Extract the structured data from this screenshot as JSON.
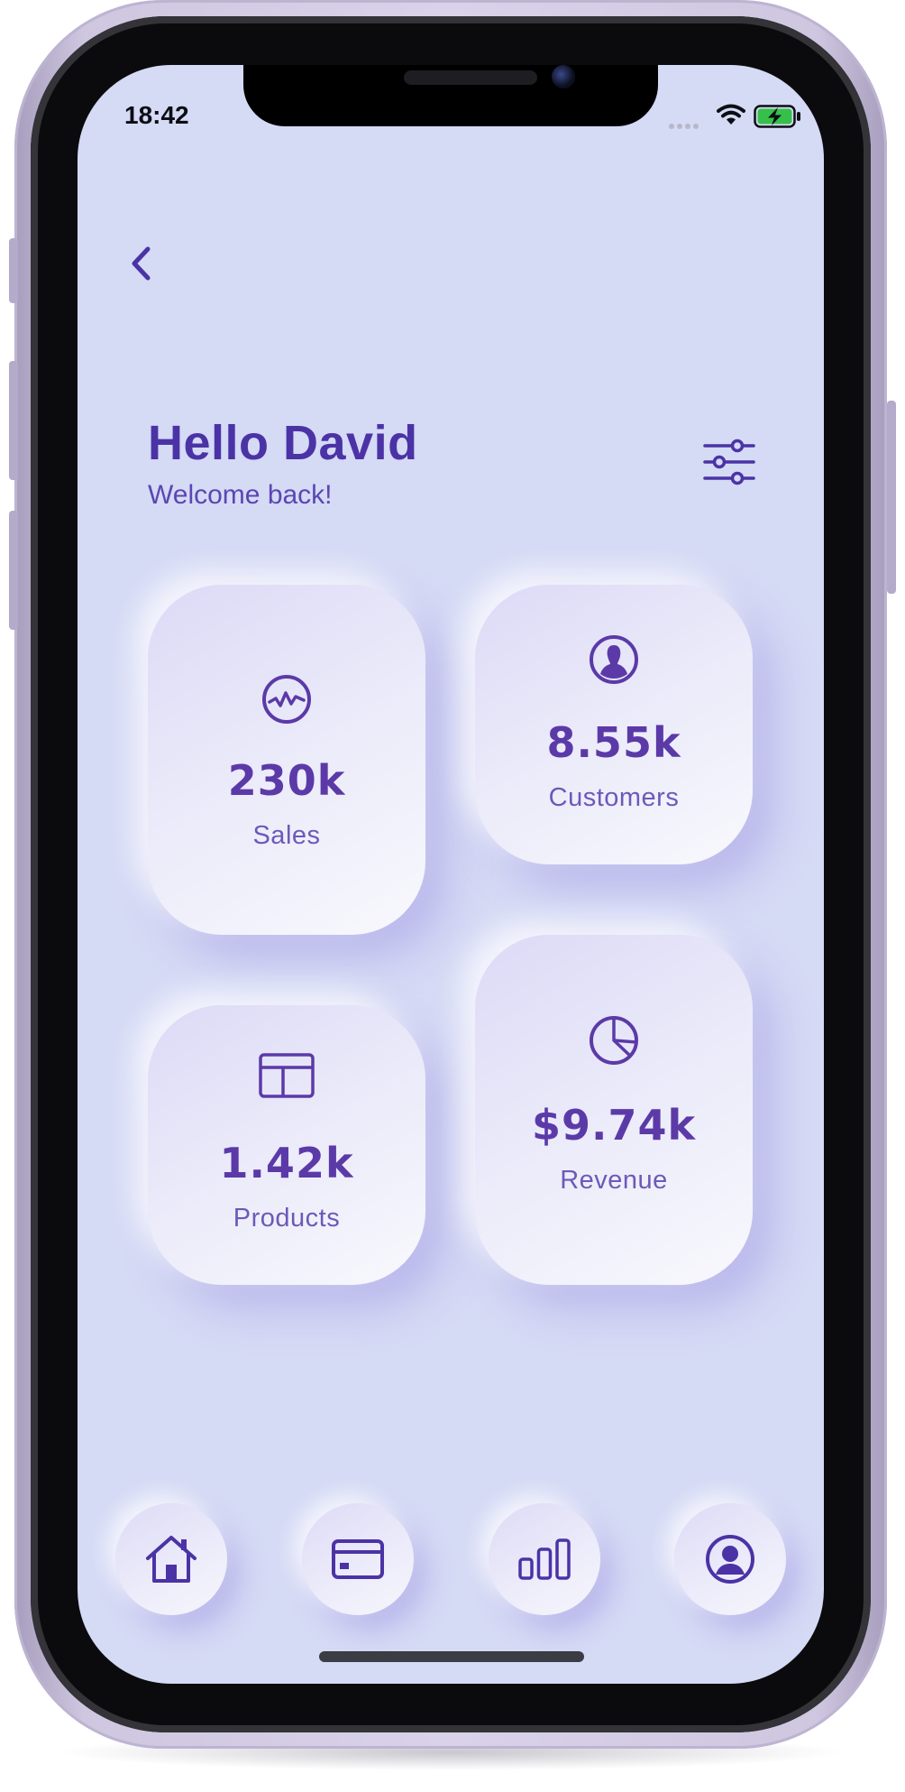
{
  "status_bar": {
    "time": "18:42"
  },
  "header": {
    "title": "Hello David",
    "subtitle": "Welcome back!"
  },
  "stats": [
    {
      "value": "230k",
      "label": "Sales",
      "icon": "activity-chart-icon"
    },
    {
      "value": "8.55k",
      "label": "Customers",
      "icon": "user-icon"
    },
    {
      "value": "1.42k",
      "label": "Products",
      "icon": "layout-icon"
    },
    {
      "value": "$9.74k",
      "label": "Revenue",
      "icon": "pie-chart-icon"
    }
  ],
  "nav": [
    {
      "icon": "home-icon"
    },
    {
      "icon": "credit-card-icon"
    },
    {
      "icon": "bar-chart-icon"
    },
    {
      "icon": "user-circle-icon"
    }
  ],
  "colors": {
    "background": "#d5daf5",
    "accent": "#4b33a6",
    "card_text": "#5b3aa8",
    "label_text": "#6d59b9"
  }
}
